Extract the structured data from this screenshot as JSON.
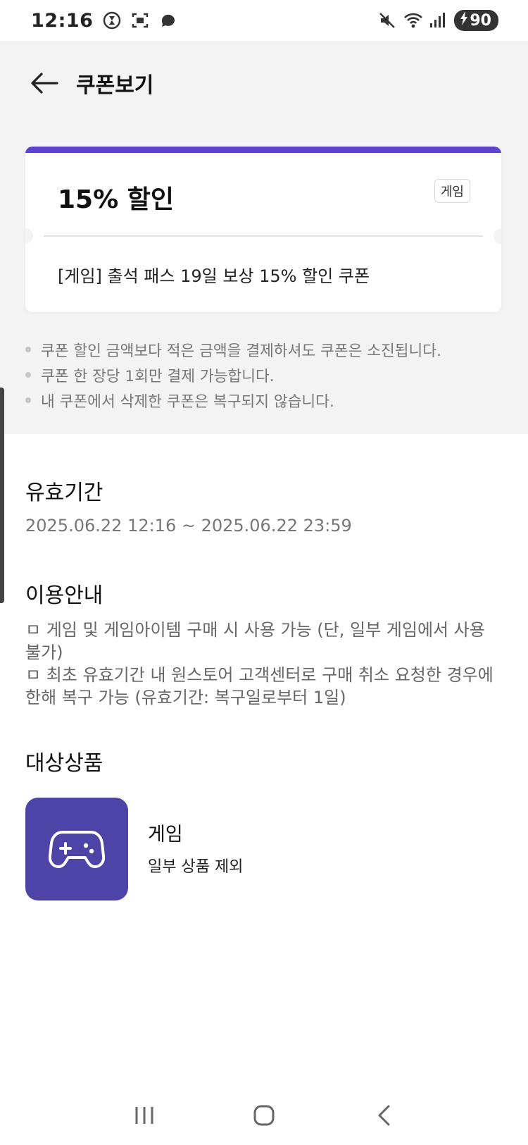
{
  "status_bar": {
    "time": "12:16",
    "battery": "90",
    "icons": [
      "hourglass-icon",
      "screen-capture-icon",
      "chat-bubble-icon",
      "mute-icon",
      "wifi-icon",
      "signal-icon",
      "charging-icon"
    ]
  },
  "header": {
    "back_icon": "arrow-left-icon",
    "title": "쿠폰보기"
  },
  "coupon": {
    "accent_color": "#5b44c9",
    "title": "15% 할인",
    "badge": "게임",
    "description": "[게임] 출석 패스 19일 보상 15% 할인 쿠폰"
  },
  "notes": [
    "쿠폰 할인 금액보다 적은 금액을 결제하셔도 쿠폰은 소진됩니다.",
    "쿠폰 한 장당 1회만 결제 가능합니다.",
    "내 쿠폰에서 삭제한 쿠폰은 복구되지 않습니다."
  ],
  "validity": {
    "title": "유효기간",
    "period": "2025.06.22 12:16 ~ 2025.06.22 23:59"
  },
  "usage": {
    "title": "이용안내",
    "lines": [
      "ㅁ 게임 및 게임아이템 구매 시 사용 가능 (단, 일부 게임에서 사용 불가)",
      "ㅁ 최초 유효기간 내 원스토어 고객센터로 구매 취소 요청한 경우에 한해 복구 가능 (유효기간: 복구일로부터 1일)"
    ]
  },
  "target": {
    "title": "대상상품",
    "product_name": "게임",
    "product_note": "일부 상품 제외",
    "icon": "gamepad-icon",
    "icon_bg": "#4e43a6"
  },
  "nav": {
    "icons": [
      "recents-icon",
      "home-icon",
      "back-icon"
    ]
  }
}
